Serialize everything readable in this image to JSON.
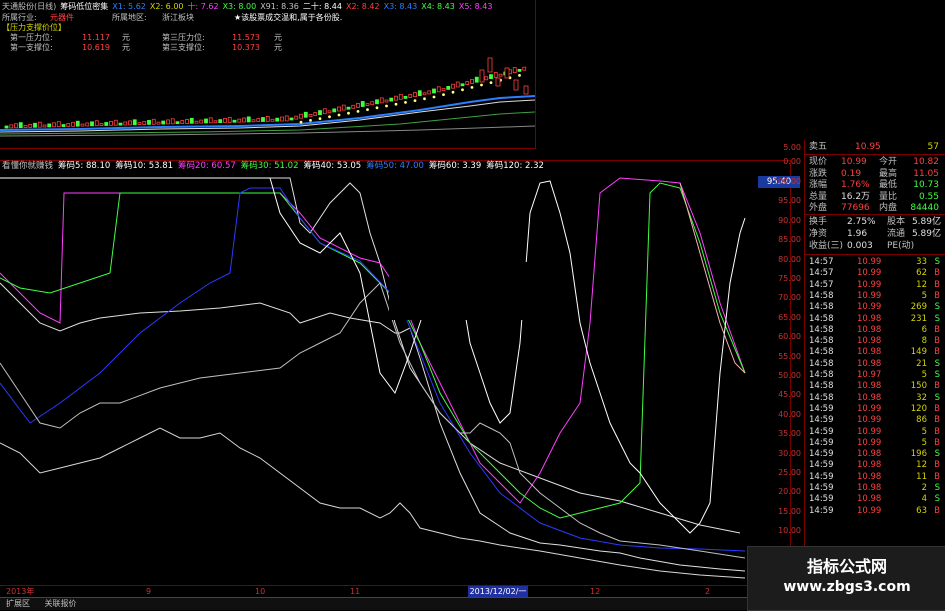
{
  "top_header": {
    "items": [
      {
        "text": "天通股份(日线)",
        "color": "#c0c0c0"
      },
      {
        "text": "筹码低位密集",
        "color": "#ffffff"
      },
      {
        "text": "X1: 5.62",
        "color": "#2a7fff"
      },
      {
        "text": "X2: 6.00",
        "color": "#d4d400"
      },
      {
        "text": "十: 7.62",
        "color": "#ff40ff"
      },
      {
        "text": "X3: 8.00",
        "color": "#40ff40"
      },
      {
        "text": "X91: 8.36",
        "color": "#c0c0c0"
      },
      {
        "text": "二十: 8.44",
        "color": "#ffffff"
      },
      {
        "text": "X2: 8.42",
        "color": "#ff4040"
      },
      {
        "text": "X3: 8.43",
        "color": "#2a7fff"
      },
      {
        "text": "X4: 8.43",
        "color": "#40ff40"
      },
      {
        "text": "X5: 8.43",
        "color": "#ff40ff"
      }
    ]
  },
  "top_info": {
    "industry_label": "所属行业:",
    "industry_value": "元器件",
    "region_label": "所属地区:",
    "region_value": "浙江板块",
    "notice": "★该股票成交温和,属于各份股.",
    "pressure_title": "【压力支撑价位】",
    "first_pressure_label": "第一压力位:",
    "first_pressure_value": "11.117",
    "first_pressure_unit": "元",
    "third_pressure_label": "第三压力位:",
    "third_pressure_value": "11.573",
    "third_pressure_unit": "元",
    "first_support_label": "第一支撑位:",
    "first_support_value": "10.619",
    "first_support_unit": "元",
    "third_support_label": "第三支撑位:",
    "third_support_value": "10.373",
    "third_support_unit": "元"
  },
  "main_header": {
    "items": [
      {
        "text": "看懂你就赚钱",
        "color": "#c0c0c0"
      },
      {
        "text": "筹码5: 88.10",
        "color": "#ffffff"
      },
      {
        "text": "筹码10: 53.81",
        "color": "#ffffff"
      },
      {
        "text": "筹码20: 60.57",
        "color": "#ff40ff"
      },
      {
        "text": "筹码30: 51.02",
        "color": "#40ff40"
      },
      {
        "text": "筹码40: 53.05",
        "color": "#ffffff"
      },
      {
        "text": "筹码50: 47.00",
        "color": "#2a7fff"
      },
      {
        "text": "筹码60: 3.39",
        "color": "#ffffff"
      },
      {
        "text": "筹码120: 2.32",
        "color": "#ffffff"
      }
    ]
  },
  "axis": {
    "labels": [
      "5.00",
      "0.00",
      "100.00",
      "95.00",
      "90.00",
      "85.00",
      "80.00",
      "75.00",
      "70.00",
      "65.00",
      "60.00",
      "55.00",
      "50.00",
      "45.00",
      "40.00",
      "35.00",
      "30.00",
      "25.00",
      "20.00",
      "15.00",
      "10.00",
      "5.00"
    ],
    "current_value": "95.40"
  },
  "date_axis": {
    "labels": [
      {
        "text": "2013年",
        "pos": 6
      },
      {
        "text": "9",
        "pos": 146
      },
      {
        "text": "10",
        "pos": 255
      },
      {
        "text": "11",
        "pos": 350
      },
      {
        "text": "12",
        "pos": 590
      },
      {
        "text": "2",
        "pos": 705
      }
    ],
    "highlight": "2013/12/02/一"
  },
  "bottom_tabs": {
    "tab1": "扩展区",
    "tab2": "关联报价"
  },
  "quote": {
    "sell5_label": "卖五",
    "sell5_price": "10.95",
    "sell5_vol": "57",
    "rows": [
      {
        "l1": "现价",
        "v1": "10.99",
        "l2": "今开",
        "v2": "10.82",
        "c1": "#ff4040",
        "c2": "#ff4040"
      },
      {
        "l1": "涨跌",
        "v1": "0.19",
        "l2": "最高",
        "v2": "11.05",
        "c1": "#ff4040",
        "c2": "#ff4040"
      },
      {
        "l1": "涨幅",
        "v1": "1.76%",
        "l2": "最低",
        "v2": "10.73",
        "c1": "#ff4040",
        "c2": "#40ff40"
      },
      {
        "l1": "总量",
        "v1": "16.2万",
        "l2": "量比",
        "v2": "0.55",
        "c1": "#e0e0e0",
        "c2": "#40ff40"
      },
      {
        "l1": "外盘",
        "v1": "77696",
        "l2": "内盘",
        "v2": "84440",
        "c1": "#ff4040",
        "c2": "#40ff40"
      }
    ],
    "rows2": [
      {
        "l1": "换手",
        "v1": "2.75%",
        "l2": "股本",
        "v2": "5.89亿"
      },
      {
        "l1": "净资",
        "v1": "1.96",
        "l2": "流通",
        "v2": "5.89亿"
      },
      {
        "l1": "收益(三)",
        "v1": "0.003",
        "l2": "PE(动)",
        "v2": ""
      }
    ],
    "ticks": [
      {
        "t": "14:57",
        "p": "10.99",
        "v": "33",
        "d": "S"
      },
      {
        "t": "14:57",
        "p": "10.99",
        "v": "62",
        "d": "B"
      },
      {
        "t": "14:57",
        "p": "10.99",
        "v": "12",
        "d": "B"
      },
      {
        "t": "14:58",
        "p": "10.99",
        "v": "5",
        "d": "B"
      },
      {
        "t": "14:58",
        "p": "10.99",
        "v": "269",
        "d": "S"
      },
      {
        "t": "14:58",
        "p": "10.98",
        "v": "231",
        "d": "S"
      },
      {
        "t": "14:58",
        "p": "10.98",
        "v": "6",
        "d": "B"
      },
      {
        "t": "14:58",
        "p": "10.98",
        "v": "8",
        "d": "B"
      },
      {
        "t": "14:58",
        "p": "10.98",
        "v": "149",
        "d": "B"
      },
      {
        "t": "14:58",
        "p": "10.98",
        "v": "21",
        "d": "S"
      },
      {
        "t": "14:58",
        "p": "10.97",
        "v": "5",
        "d": "S"
      },
      {
        "t": "14:58",
        "p": "10.98",
        "v": "150",
        "d": "B"
      },
      {
        "t": "14:58",
        "p": "10.98",
        "v": "32",
        "d": "S"
      },
      {
        "t": "14:59",
        "p": "10.99",
        "v": "120",
        "d": "B"
      },
      {
        "t": "14:59",
        "p": "10.99",
        "v": "86",
        "d": "B"
      },
      {
        "t": "14:59",
        "p": "10.99",
        "v": "5",
        "d": "B"
      },
      {
        "t": "14:59",
        "p": "10.99",
        "v": "5",
        "d": "B"
      },
      {
        "t": "14:59",
        "p": "10.98",
        "v": "196",
        "d": "S"
      },
      {
        "t": "14:59",
        "p": "10.98",
        "v": "12",
        "d": "B"
      },
      {
        "t": "14:59",
        "p": "10.98",
        "v": "11",
        "d": "B"
      },
      {
        "t": "14:59",
        "p": "10.98",
        "v": "2",
        "d": "S"
      },
      {
        "t": "14:59",
        "p": "10.98",
        "v": "4",
        "d": "S"
      },
      {
        "t": "14:59",
        "p": "10.99",
        "v": "63",
        "d": "B"
      }
    ]
  },
  "watermark": {
    "title": "指标公式网",
    "url": "www.zbgs3.com"
  },
  "colors": {
    "red": "#ff4040",
    "green": "#40ff40",
    "yellow": "#d4d400",
    "magenta": "#ff40ff",
    "blue": "#2a7fff",
    "border": "#7a0000"
  }
}
